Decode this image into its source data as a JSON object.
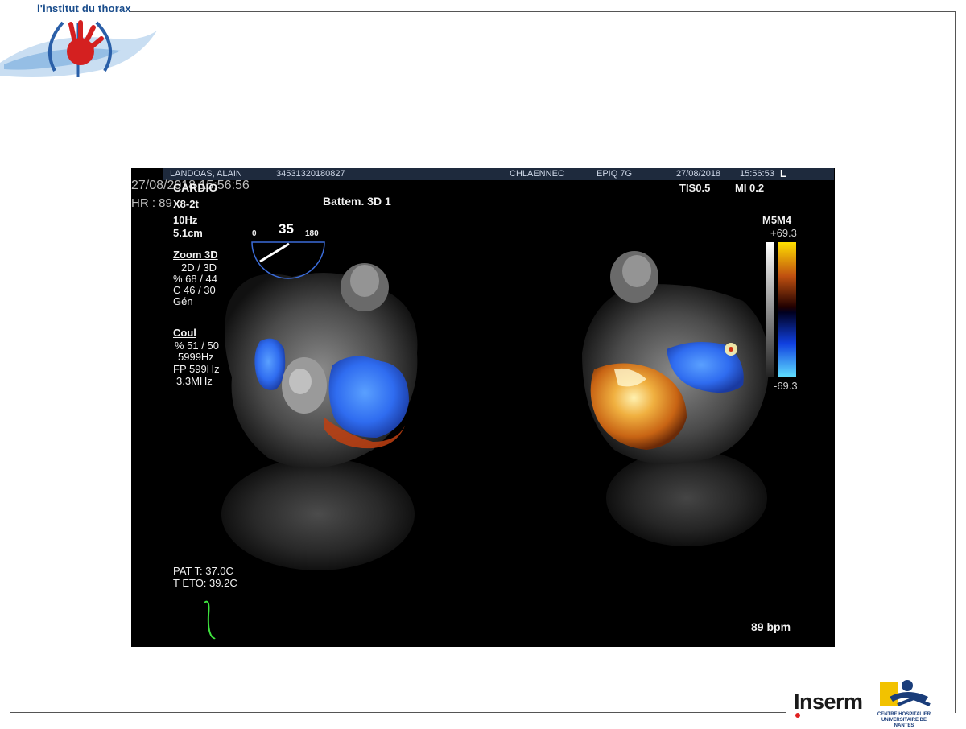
{
  "header": {
    "brand": "l'institut du thorax"
  },
  "ultrasound": {
    "patient_bar": {
      "name": "LANDOAS, ALAIN",
      "id": "34531320180827",
      "hospital": "CHLAENNEC",
      "probe_name": "EPIQ 7G",
      "date": "27/08/2018",
      "time": "15:56:53",
      "corner": "L"
    },
    "overlay_left": {
      "datetime": "27/08/2018 15:56:56",
      "hr": "HR : 89",
      "mode": "CARDIO",
      "probe": "X8-2t",
      "frame_rate": "10Hz",
      "depth": "5.1cm",
      "zoom_title": "Zoom 3D",
      "zoom_lines": [
        "2D / 3D",
        "% 68 / 44",
        "C 46 / 30",
        "Gén"
      ],
      "color_title": "Coul",
      "color_lines": [
        "% 51 / 50",
        "5999Hz",
        "FP 599Hz",
        "3.3MHz"
      ],
      "temps": [
        "PAT T: 37.0C",
        "T ETO: 39.2C"
      ]
    },
    "label_center": "Battem. 3D 1",
    "angle": {
      "min": "0",
      "value": "35",
      "max": "180"
    },
    "top_right": {
      "tis": "TIS0.5",
      "mi": "MI 0.2"
    },
    "color_scale": {
      "label": "M5M4",
      "max": "+69.3",
      "min": "-69.3"
    },
    "bpm": "89 bpm"
  },
  "footer": {
    "inserm": "Inserm",
    "chu_line1": "CENTRE HOSPITALIER",
    "chu_line2": "UNIVERSITAIRE DE NANTES"
  },
  "colors": {
    "brand_blue": "#1a4d8c",
    "logo_red": "#d42020",
    "doppler_blue": "#2f6cf0",
    "doppler_orange": "#e08a1a"
  }
}
